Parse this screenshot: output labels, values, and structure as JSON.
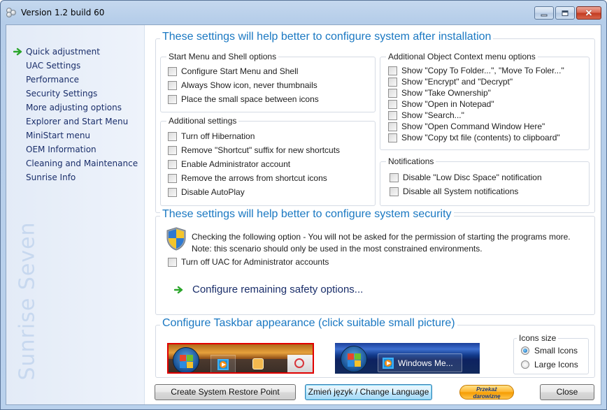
{
  "window": {
    "title": "Version 1.2 build 60",
    "controls": {
      "minimize": "minimize",
      "maximize": "maximize",
      "close": "close"
    }
  },
  "sidebar": {
    "items": [
      {
        "label": "Quick adjustment",
        "active": true
      },
      {
        "label": "UAC Settings"
      },
      {
        "label": "Performance"
      },
      {
        "label": "Security Settings"
      },
      {
        "label": "More adjusting options"
      },
      {
        "label": "Explorer and Start Menu"
      },
      {
        "label": "MiniStart menu"
      },
      {
        "label": "OEM Information"
      },
      {
        "label": "Cleaning and Maintenance"
      },
      {
        "label": "Sunrise Info"
      }
    ],
    "brand": "Sunrise Seven"
  },
  "section_install": {
    "title": "These settings will help better to configure system after installation",
    "start_menu": {
      "title": "Start Menu and Shell options",
      "options": [
        {
          "label": "Configure Start Menu and Shell",
          "checked": false
        },
        {
          "label": "Always Show icon, never thumbnails",
          "checked": false
        },
        {
          "label": "Place the small space between icons",
          "checked": false
        }
      ]
    },
    "additional": {
      "title": "Additional settings",
      "options": [
        {
          "label": "Turn off Hibernation",
          "checked": false
        },
        {
          "label": "Remove \"Shortcut\" suffix for new shortcuts",
          "checked": false
        },
        {
          "label": "Enable Administrator account",
          "checked": false
        },
        {
          "label": "Remove the arrows from shortcut icons",
          "checked": false
        },
        {
          "label": "Disable AutoPlay",
          "checked": false
        }
      ]
    },
    "context_menu": {
      "title": "Additional Object Context menu options",
      "options": [
        {
          "label": "Show \"Copy To Folder...\", \"Move To Foler...\"",
          "checked": false
        },
        {
          "label": "Show \"Encrypt\" and \"Decrypt\"",
          "checked": false
        },
        {
          "label": "Show \"Take Ownership\"",
          "checked": false
        },
        {
          "label": "Show \"Open in Notepad\"",
          "checked": false
        },
        {
          "label": "Show \"Search...\"",
          "checked": false
        },
        {
          "label": "Show \"Open Command Window Here\"",
          "checked": false
        },
        {
          "label": "Show \"Copy txt file (contents) to clipboard\"",
          "checked": false
        }
      ]
    },
    "notifications": {
      "title": "Notifications",
      "options": [
        {
          "label": "Disable \"Low Disc Space\" notification",
          "checked": false
        },
        {
          "label": "Disable all System notifications",
          "checked": false
        }
      ]
    }
  },
  "section_security": {
    "title": "These settings will help better to configure system security",
    "line1": "Checking the following option - You will not be asked for the permission of starting the programs more.",
    "line2": "Note: this scenario should only be used in the most constrained environments.",
    "option": {
      "label": "Turn off UAC for Administrator accounts",
      "checked": false
    },
    "link": "Configure remaining safety options..."
  },
  "section_taskbar": {
    "title": "Configure Taskbar appearance (click suitable small picture)",
    "thumbnails": [
      {
        "name": "icons-only taskbar",
        "selected": true
      },
      {
        "name": "labeled taskbar",
        "button_label": "Windows Me...",
        "selected": false
      }
    ],
    "icons_size": {
      "title": "Icons size",
      "options": [
        {
          "label": "Small Icons",
          "selected": true
        },
        {
          "label": "Large Icons",
          "selected": false
        }
      ]
    }
  },
  "footer": {
    "restore_point": "Create System Restore Point",
    "change_language": "Zmień język / Change Language",
    "donate_line1": "Przekaż",
    "donate_line2": "darowiznę",
    "close": "Close"
  },
  "colors": {
    "accent_title": "#1a78c2",
    "nav_text": "#1a2e6a",
    "selected_thumb_border": "#e00000",
    "arrow_green": "#2aa52a"
  }
}
